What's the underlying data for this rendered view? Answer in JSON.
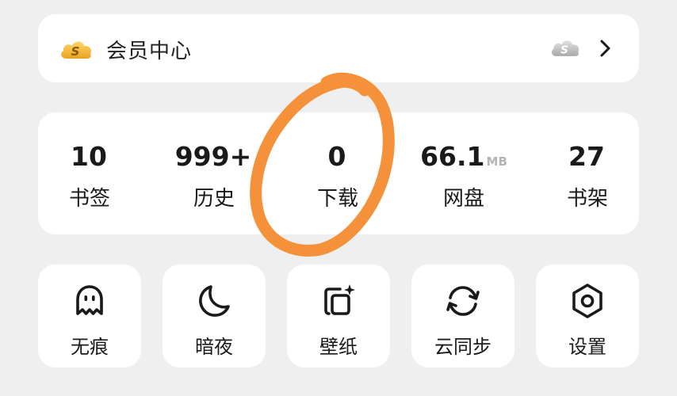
{
  "member": {
    "title": "会员中心",
    "icon_left": "gold-cloud-s-icon",
    "icon_right": "gray-cloud-s-icon",
    "chevron": "chevron-right-icon"
  },
  "stats": [
    {
      "value": "10",
      "unit": "",
      "label": "书签"
    },
    {
      "value": "999+",
      "unit": "",
      "label": "历史"
    },
    {
      "value": "0",
      "unit": "",
      "label": "下载"
    },
    {
      "value": "66.1",
      "unit": "MB",
      "label": "网盘"
    },
    {
      "value": "27",
      "unit": "",
      "label": "书架"
    }
  ],
  "tiles": [
    {
      "label": "无痕",
      "icon": "ghost-icon"
    },
    {
      "label": "暗夜",
      "icon": "moon-icon"
    },
    {
      "label": "壁纸",
      "icon": "wallpaper-icon"
    },
    {
      "label": "云同步",
      "icon": "sync-icon"
    },
    {
      "label": "设置",
      "icon": "settings-hexagon-icon"
    }
  ],
  "colors": {
    "background": "#efefef",
    "card": "#ffffff",
    "gold": "#f2b63a",
    "annotation": "#f4913a",
    "unit_gray": "#b4b4b4"
  }
}
